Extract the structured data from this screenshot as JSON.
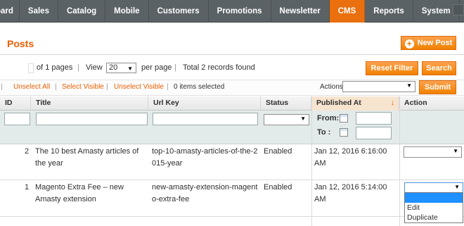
{
  "nav": {
    "items": [
      "oard",
      "Sales",
      "Catalog",
      "Mobile",
      "Customers",
      "Promotions",
      "Newsletter",
      "CMS",
      "Reports",
      "System"
    ],
    "active": "CMS"
  },
  "header": {
    "title": "Posts",
    "new_post_label": "New Post"
  },
  "pager": {
    "of_pages": "of 1 pages",
    "view_label": "View",
    "per_page_value": "20",
    "per_page_label": "per page",
    "records": "Total 2 records found",
    "reset_filter_label": "Reset Filter",
    "search_label": "Search"
  },
  "massaction": {
    "unselect_all": "Unselect All",
    "select_visible": "Select Visible",
    "unselect_visible": "Unselect Visible",
    "selected_count": "0 items selected",
    "actions_label": "Actions",
    "submit_label": "Submit"
  },
  "grid": {
    "columns": [
      "ID",
      "Title",
      "Url Key",
      "Status",
      "Published At",
      "Action"
    ],
    "sorted_column": "Published At",
    "filter": {
      "from_label": "From:",
      "to_label": "To :"
    },
    "rows": [
      {
        "id": "2",
        "title": "The 10 best Amasty articles of the year",
        "url_key": "top-10-amasty-articles-of-the-2015-year",
        "status": "Enabled",
        "published": "Jan 12, 2016 6:16:00 AM"
      },
      {
        "id": "1",
        "title": "Magento Extra Fee – new Amasty extension",
        "url_key": "new-amasty-extension-magento-extra-fee",
        "status": "Enabled",
        "published": "Jan 12, 2016 5:14:00 AM"
      }
    ],
    "action_options": [
      "Edit",
      "Duplicate"
    ]
  },
  "colors": {
    "accent": "#eb5e00",
    "nav": "#5b6266",
    "nav_active": "#e96f0f",
    "filter_row": "#e3eaea"
  }
}
